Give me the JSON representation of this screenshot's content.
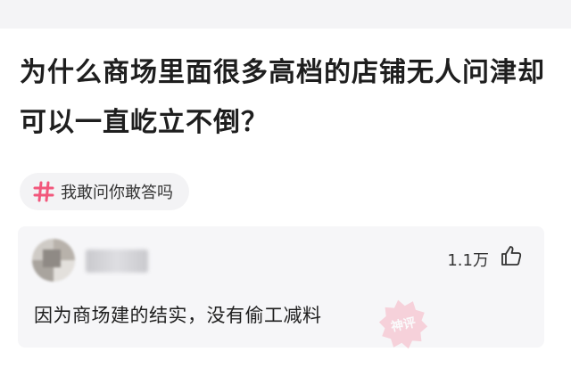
{
  "question": {
    "title": "为什么商场里面很多高档的店铺无人问津却可以一直屹立不倒？"
  },
  "topic": {
    "icon": "hash-icon",
    "label": "我敢问你敢答吗",
    "accent_color": "#f2577c"
  },
  "answer": {
    "like_count": "1.1万",
    "like_icon": "thumbs-up-icon",
    "text": "因为商场建的结实，没有偷工减料",
    "watermark": "神评"
  }
}
